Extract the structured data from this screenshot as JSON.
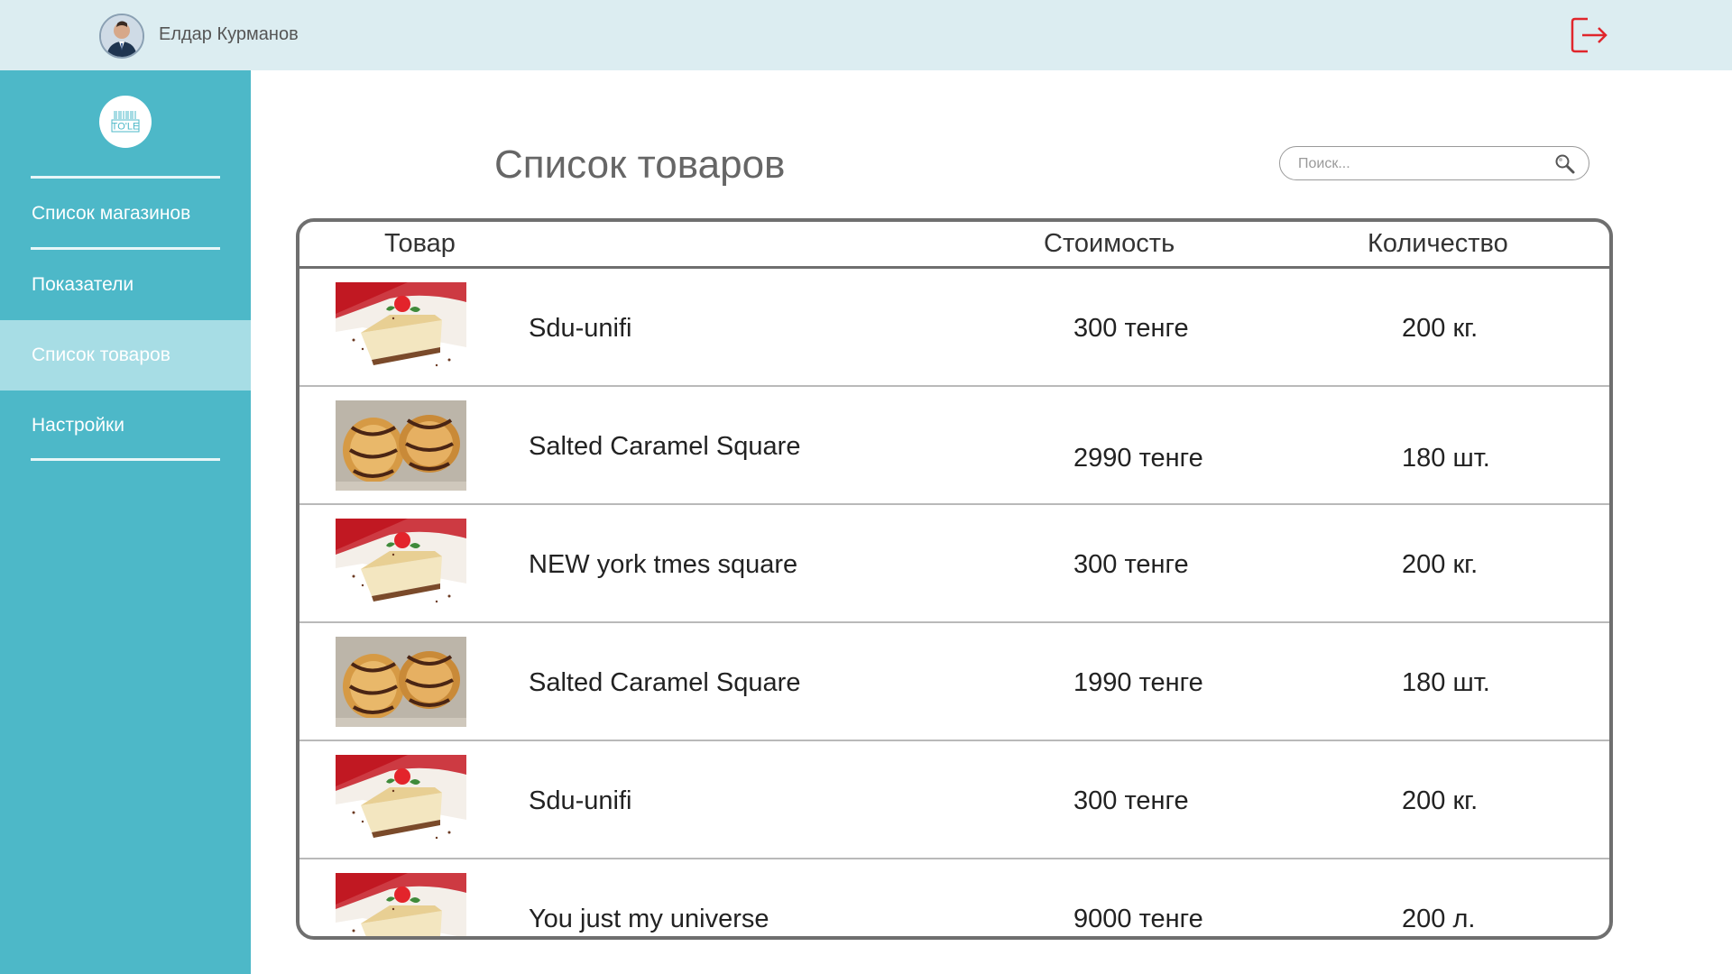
{
  "header": {
    "user_name": "Елдар Курманов",
    "logout_icon": "logout-icon",
    "accent": "#e0262c"
  },
  "sidebar": {
    "logo_text": "TO'LE",
    "items": [
      {
        "label": "Список магазинов",
        "active": false
      },
      {
        "label": "Показатели",
        "active": false
      },
      {
        "label": "Список товаров",
        "active": true
      },
      {
        "label": "Настройки",
        "active": false
      }
    ],
    "bg_color": "#4db8c8",
    "active_color": "#a7dde5"
  },
  "main": {
    "title": "Список товаров",
    "search": {
      "placeholder": "Поиск...",
      "value": "",
      "icon": "search-icon"
    },
    "table": {
      "columns": [
        "Товар",
        "Стоимость",
        "Количество"
      ],
      "rows": [
        {
          "image": "cheesecake",
          "name": "Sdu-unifi",
          "price": "300 тенге",
          "qty": "200 кг."
        },
        {
          "image": "baklava",
          "name": "Salted Caramel Square",
          "price": "2990 тенге",
          "qty": "180 шт."
        },
        {
          "image": "cheesecake",
          "name": "NEW york tmes square",
          "price": "300 тенге",
          "qty": "200 кг."
        },
        {
          "image": "baklava",
          "name": "Salted Caramel Square",
          "price": "1990 тенге",
          "qty": "180 шт."
        },
        {
          "image": "cheesecake",
          "name": "Sdu-unifi",
          "price": "300 тенге",
          "qty": "200 кг."
        },
        {
          "image": "cheesecake",
          "name": "You just my universe",
          "price": "9000 тенге",
          "qty": "200 л."
        }
      ]
    }
  }
}
